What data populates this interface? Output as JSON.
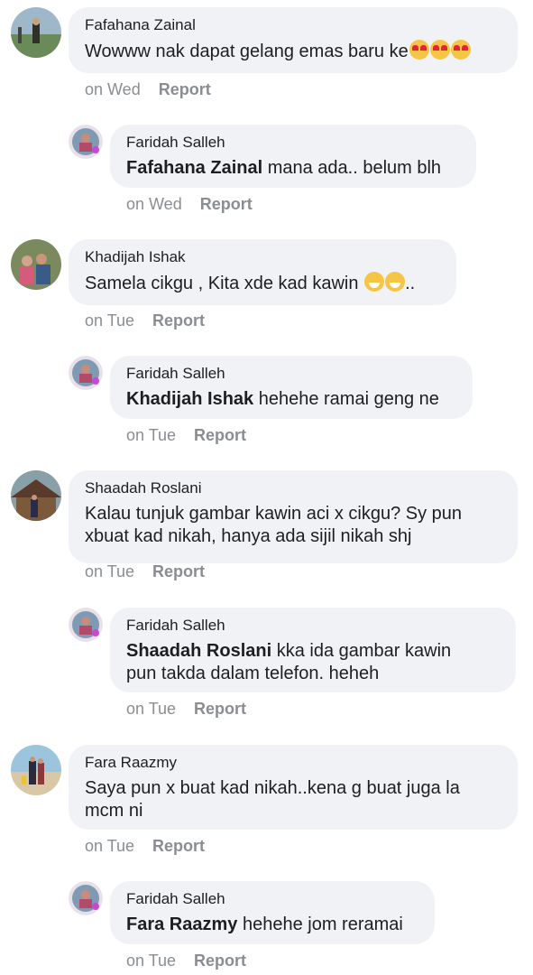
{
  "comments": [
    {
      "name": "Fafahana Zainal",
      "text": "Wowww nak dapat gelang emas baru ke",
      "time": "on Wed",
      "report": "Report",
      "reply": {
        "name": "Faridah Salleh",
        "mention": "Fafahana Zainal",
        "text": " mana ada.. belum blh",
        "time": "on Wed",
        "report": "Report"
      }
    },
    {
      "name": "Khadijah Ishak",
      "text": "Samela cikgu , Kita xde kad kawin",
      "text_suffix": "..",
      "time": "on Tue",
      "report": "Report",
      "reply": {
        "name": "Faridah Salleh",
        "mention": "Khadijah Ishak",
        "text": " hehehe ramai geng ne",
        "time": "on Tue",
        "report": "Report"
      }
    },
    {
      "name": "Shaadah Roslani",
      "text_line1": "Kalau tunjuk gambar kawin aci x cikgu? Sy pun",
      "text_line2": "xbuat kad nikah, hanya ada sijil nikah shj",
      "time": "on Tue",
      "report": "Report",
      "reply": {
        "name": "Faridah Salleh",
        "mention": "Shaadah Roslani",
        "text_line1": " kka ida gambar kawin",
        "text_line2": "pun takda dalam telefon. heheh",
        "time": "on Tue",
        "report": "Report"
      }
    },
    {
      "name": "Fara Raazmy",
      "text_line1": "Saya pun x buat kad nikah..kena g buat juga la",
      "text_line2": "mcm ni",
      "time": "on Tue",
      "report": "Report",
      "reply": {
        "name": "Faridah Salleh",
        "mention": "Fara Raazmy",
        "text": " hehehe jom reramai",
        "time": "on Tue",
        "report": "Report"
      }
    }
  ],
  "colors": {
    "bubble": "#f0f2f5",
    "meta": "#8a8d91",
    "text": "#1c1e21"
  }
}
